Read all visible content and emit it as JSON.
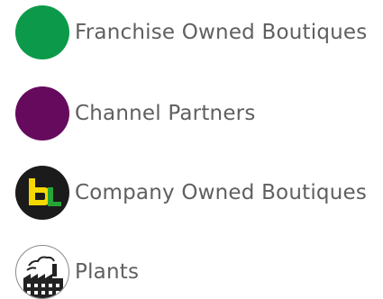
{
  "legend": {
    "items": [
      {
        "label": "Franchise Owned Boutiques",
        "marker_type": "circle",
        "color": "#0c9a4a"
      },
      {
        "label": "Channel Partners",
        "marker_type": "circle",
        "color": "#660a5e"
      },
      {
        "label": "Company Owned Boutiques",
        "marker_type": "logo-icon",
        "logo_colors": [
          "#1b1b1b",
          "#f5d800",
          "#26a537"
        ]
      },
      {
        "label": "Plants",
        "marker_type": "factory-icon",
        "color": "#000000"
      }
    ]
  }
}
